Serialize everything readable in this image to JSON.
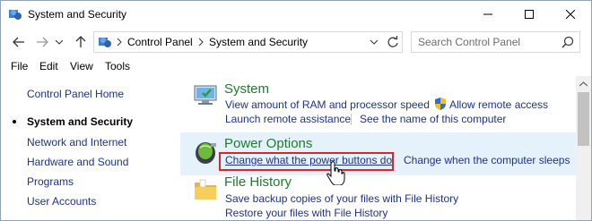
{
  "window": {
    "title": "System and Security",
    "controls": [
      "minimize",
      "maximize",
      "close"
    ]
  },
  "address_bar": {
    "segments": [
      "Control Panel",
      "System and Security"
    ],
    "icon": "control-panel-icon"
  },
  "search": {
    "placeholder": "Search Control Panel"
  },
  "menu": [
    "File",
    "Edit",
    "View",
    "Tools"
  ],
  "left_nav": {
    "items": [
      {
        "label": "Control Panel Home",
        "current": false
      },
      {
        "label": "System and Security",
        "current": true
      },
      {
        "label": "Network and Internet",
        "current": false
      },
      {
        "label": "Hardware and Sound",
        "current": false
      },
      {
        "label": "Programs",
        "current": false
      },
      {
        "label": "User Accounts",
        "current": false
      }
    ]
  },
  "categories": {
    "system": {
      "title": "System",
      "icon": "computer-icon",
      "tasks": [
        "View amount of RAM and processor speed",
        "Allow remote access",
        "Launch remote assistance",
        "See the name of this computer"
      ]
    },
    "power": {
      "title": "Power Options",
      "icon": "battery-icon",
      "tasks": [
        "Change what the power buttons do",
        "Change when the computer sleeps"
      ]
    },
    "history": {
      "title": "File History",
      "icon": "folder-icon",
      "tasks": [
        "Save backup copies of your files with File History",
        "Restore your files with File History"
      ]
    }
  },
  "colors": {
    "link": "#1e3287",
    "category_title": "#217a2e",
    "highlight_row": "#e5f1fb",
    "annotation_box": "#d9262a"
  }
}
